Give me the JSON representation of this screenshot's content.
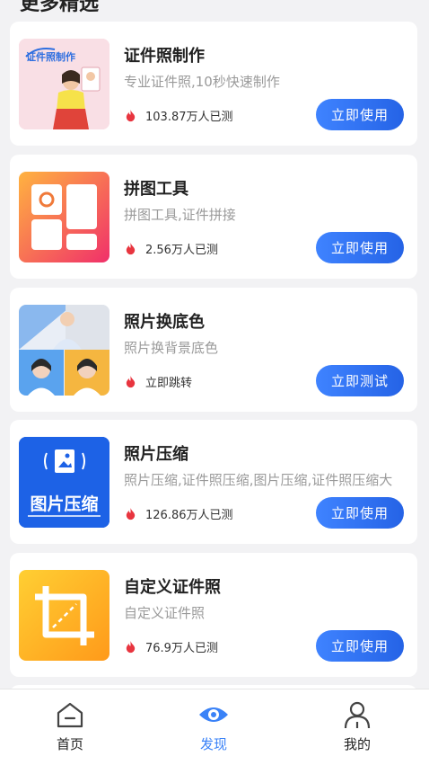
{
  "header": {
    "partial_title": "更多精选"
  },
  "tools": [
    {
      "title": "证件照制作",
      "desc": "专业证件照,10秒快速制作",
      "stat": "103.87万人已测",
      "button": "立即使用",
      "thumb_text": "证件照制作"
    },
    {
      "title": "拼图工具",
      "desc": "拼图工具,证件拼接",
      "stat": "2.56万人已测",
      "button": "立即使用"
    },
    {
      "title": "照片换底色",
      "desc": "照片换背景底色",
      "stat": "立即跳转",
      "button": "立即测试"
    },
    {
      "title": "照片压缩",
      "desc": "照片压缩,证件照压缩,图片压缩,证件照压缩大",
      "stat": "126.86万人已测",
      "button": "立即使用",
      "thumb_text": "图片压缩"
    },
    {
      "title": "自定义证件照",
      "desc": "自定义证件照",
      "stat": "76.9万人已测",
      "button": "立即使用"
    }
  ],
  "tabbar": {
    "home": "首页",
    "discover": "发现",
    "mine": "我的"
  },
  "colors": {
    "accent": "#3a82f7",
    "flame": "#e8353f"
  }
}
